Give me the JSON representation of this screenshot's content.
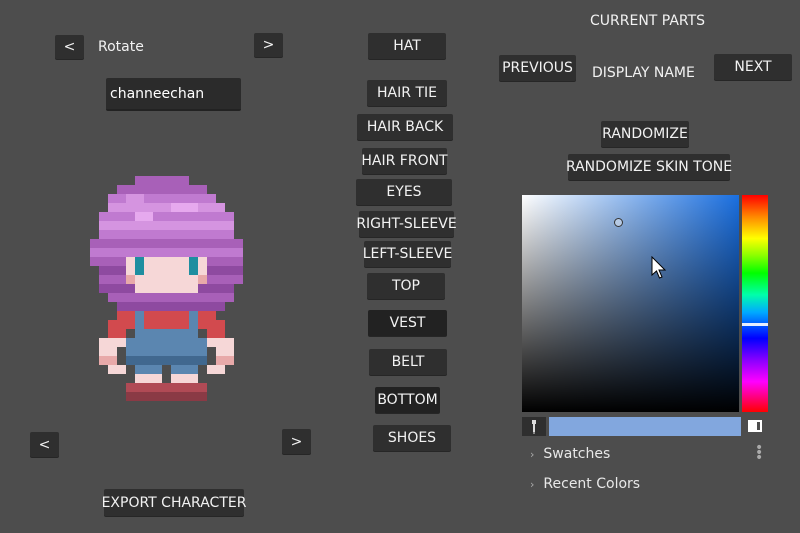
{
  "rotate": {
    "label": "Rotate",
    "prev": "<",
    "next": ">"
  },
  "name_field": {
    "value": "channeechan"
  },
  "sprite_nav": {
    "prev": "<",
    "next": ">"
  },
  "export_label": "EXPORT CHARACTER",
  "parts": [
    "HAT",
    "HAIR TIE",
    "HAIR BACK",
    "HAIR FRONT",
    "EYES",
    "RIGHT-SLEEVE",
    "LEFT-SLEEVE",
    "TOP",
    "VEST",
    "BELT",
    "BOTTOM",
    "SHOES"
  ],
  "active_part": "VEST",
  "current_parts": {
    "title": "CURRENT PARTS",
    "previous": "PREVIOUS",
    "display_name": "DISPLAY NAME",
    "next": "NEXT"
  },
  "randomize": "RANDOMIZE",
  "randomize_skin": "RANDOMIZE SKIN TONE",
  "color_picker": {
    "base_hue_color": "#1a6fe0",
    "picked_color": "#82a7de",
    "swatches_label": "Swatches",
    "recent_label": "Recent Colors"
  },
  "icons": {
    "eyedropper": "eyedropper-icon",
    "alpha": "alpha-toggle-icon",
    "cursor": "mouse-cursor-icon",
    "menu": "kebab-menu-icon",
    "expand": "chevron-right-icon"
  }
}
